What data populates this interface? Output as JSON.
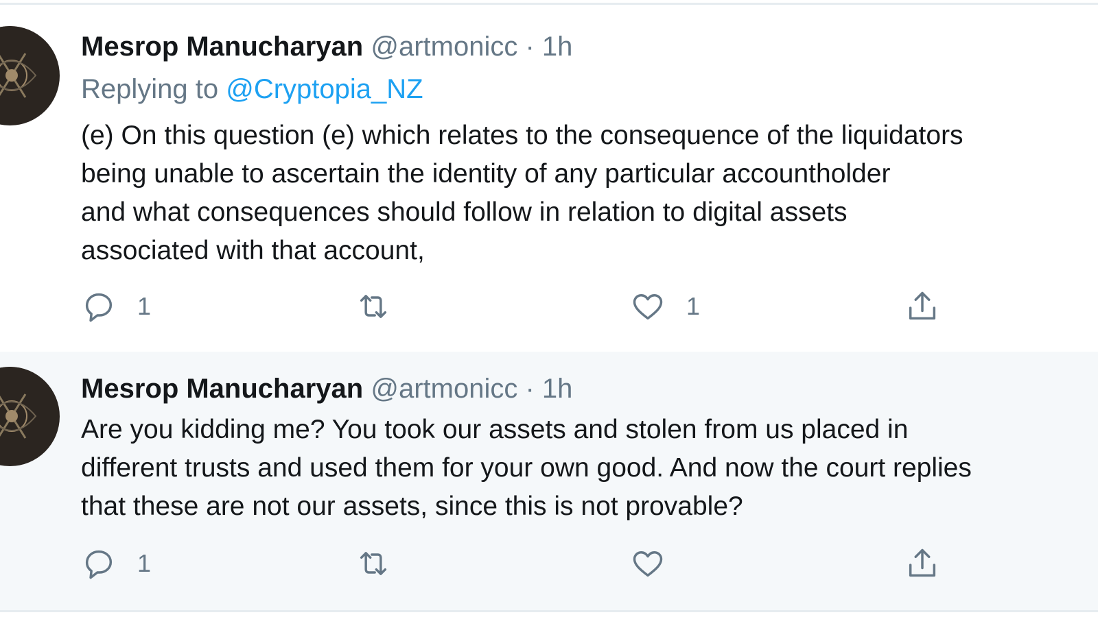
{
  "tweets": [
    {
      "author_name": "Mesrop Manucharyan",
      "handle": "@artmonicc",
      "separator": "·",
      "time": "1h",
      "replying_prefix": "Replying to ",
      "replying_to": "@Cryptopia_NZ",
      "text": "(e) On this question (e) which relates to the consequence of the liquidators\nbeing unable to ascertain the identity of any particular accountholder\nand what consequences should follow in relation to digital assets\nassociated with that account,",
      "reply_count": "1",
      "retweet_count": "",
      "like_count": "1"
    },
    {
      "author_name": "Mesrop Manucharyan",
      "handle": "@artmonicc",
      "separator": "·",
      "time": "1h",
      "text": "Are you kidding me? You took our assets and stolen from us placed in\ndifferent trusts and used them for your own good. And now the court replies\nthat these are not our assets, since this is not provable?",
      "reply_count": "1",
      "retweet_count": "",
      "like_count": ""
    }
  ],
  "icons": {
    "reply": "reply-icon",
    "retweet": "retweet-icon",
    "like": "heart-icon",
    "share": "share-icon"
  },
  "colors": {
    "link": "#1da1f2",
    "secondary_text": "#657786",
    "primary_text": "#14171a",
    "highlight_background": "#f5f8fa",
    "thread_line": "#ccd6dd"
  }
}
